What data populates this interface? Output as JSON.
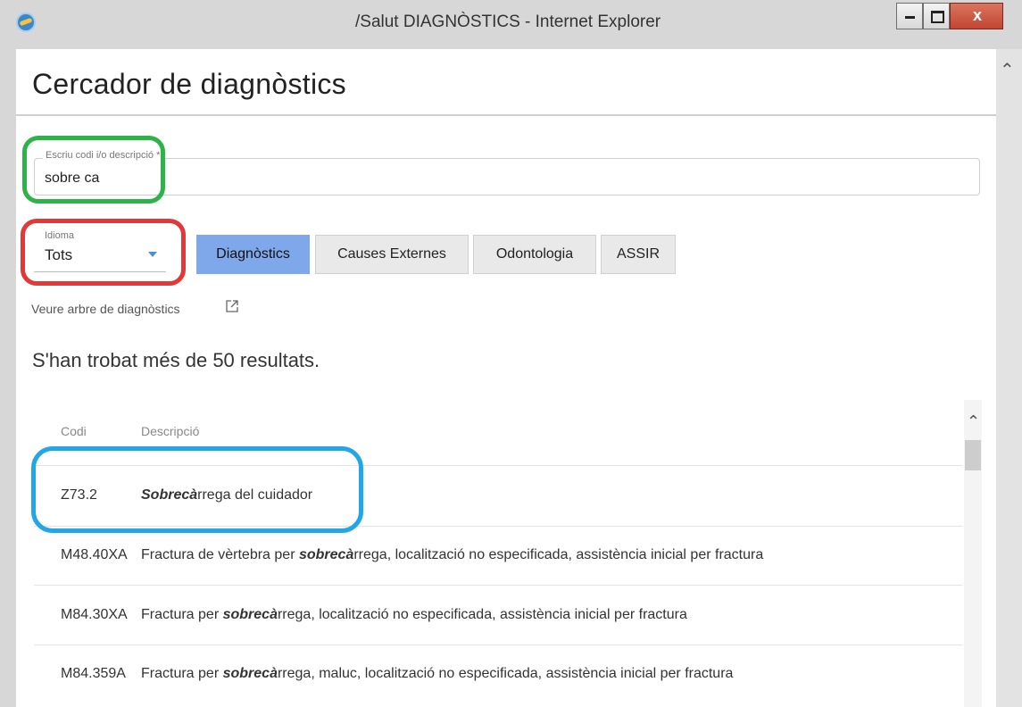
{
  "window": {
    "title": "/Salut DIAGNÒSTICS - Internet Explorer",
    "close_glyph": "x"
  },
  "page": {
    "title": "Cercador de diagnòstics"
  },
  "search": {
    "label": "Escriu codi i/o descripció *",
    "value": "sobre ca"
  },
  "language": {
    "label": "Idioma",
    "value": "Tots"
  },
  "tabs": [
    {
      "label": "Diagnòstics",
      "active": true
    },
    {
      "label": "Causes Externes",
      "active": false
    },
    {
      "label": "Odontologia",
      "active": false
    },
    {
      "label": "ASSIR",
      "active": false
    }
  ],
  "tree_link": "Veure arbre de diagnòstics",
  "results": {
    "summary": "S'han trobat més de 50 resultats.",
    "columns": {
      "code": "Codi",
      "description": "Descripció"
    },
    "rows": [
      {
        "code": "Z73.2",
        "match": "Sobrecà",
        "rest": "rrega del cuidador"
      },
      {
        "code": "M48.40XA",
        "pre": "Fractura de vèrtebra per ",
        "match": "sobrecà",
        "rest": "rrega, localització no especificada, assistència inicial per fractura"
      },
      {
        "code": "M84.30XA",
        "pre": "Fractura per ",
        "match": "sobrecà",
        "rest": "rrega, localització no especificada, assistència inicial per fractura"
      },
      {
        "code": "M84.359A",
        "pre": "Fractura per ",
        "match": "sobrecà",
        "rest": "rrega, maluc, localització no especificada, assistència inicial per fractura"
      }
    ]
  },
  "colors": {
    "active_tab": "#7fa8eb",
    "highlight_green": "#2db34a",
    "highlight_red": "#e23838",
    "highlight_blue": "#22a7e6"
  }
}
